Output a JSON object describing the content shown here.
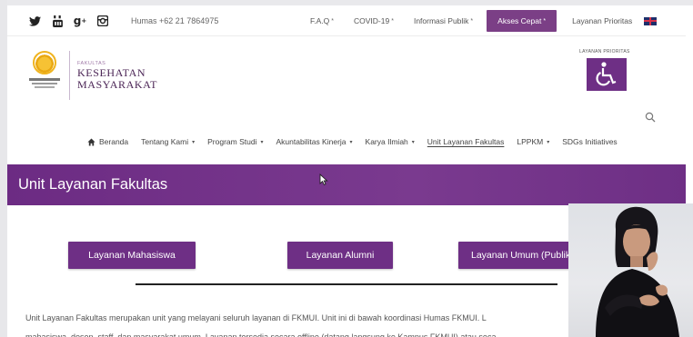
{
  "topbar": {
    "social_icons": [
      "twitter-icon",
      "youtube-icon",
      "google-plus-icon",
      "instagram-icon"
    ],
    "humas": "Humas +62 21 7864975",
    "links": [
      {
        "label": "F.A.Q",
        "star": "*"
      },
      {
        "label": "COVID-19",
        "star": "*"
      },
      {
        "label": "Informasi Publik",
        "star": "*"
      },
      {
        "label": "Akses Cepat",
        "star": "*"
      },
      {
        "label": "Layanan Prioritas",
        "star": ""
      }
    ],
    "flag_icon": "uk-flag-icon"
  },
  "logo": {
    "fakultas": "FAKULTAS",
    "line1": "KESEHATAN",
    "line2": "MASYARAKAT"
  },
  "prioritas": {
    "label": "LAYANAN PRIORITAS",
    "icon": "wheelchair-icon"
  },
  "mainnav": {
    "items": [
      {
        "label": "Beranda",
        "caret": ""
      },
      {
        "label": "Tentang Kami",
        "caret": "▾"
      },
      {
        "label": "Program Studi",
        "caret": "▾"
      },
      {
        "label": "Akuntabilitas Kinerja",
        "caret": "▾"
      },
      {
        "label": "Karya Ilmiah",
        "caret": "▾"
      },
      {
        "label": "Unit Layanan Fakultas",
        "caret": ""
      },
      {
        "label": "LPPKM",
        "caret": "▾"
      },
      {
        "label": "SDGs Initiatives",
        "caret": ""
      }
    ]
  },
  "banner": {
    "title": "Unit Layanan Fakultas"
  },
  "buttons": {
    "mahasiswa": "Layanan Mahasiswa",
    "alumni": "Layanan Alumni",
    "umum": "Layanan Umum (Publik/Ekster"
  },
  "paragraph": {
    "line1": "Unit Layanan Fakultas merupakan unit yang melayani seluruh layanan di FKMUI. Unit ini di bawah koordinasi Humas FKMUI. L",
    "line2": "mahasiswa, dosen, staff, dan masyarakat umum. Layanan tersedia secara offline (datang langsung ke Kampus FKMUI) atau seca"
  },
  "colors": {
    "brand_purple": "#6e2f85",
    "banner_purple": "#732f88"
  }
}
